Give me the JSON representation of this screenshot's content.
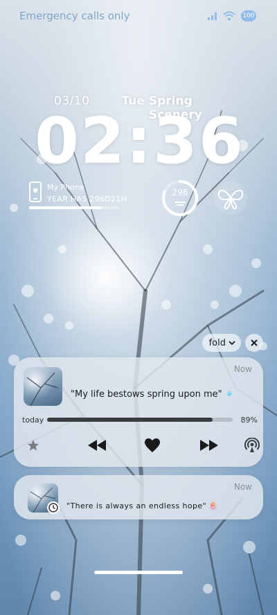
{
  "status_bar": {
    "carrier_text": "Emergency calls only",
    "battery_level": "100",
    "icons": [
      "signal-icon",
      "wifi-icon",
      "battery-icon"
    ]
  },
  "lockscreen": {
    "date": "03/10",
    "weekday": "Tue",
    "subtitle": "Spring Scenery",
    "time": "02:36"
  },
  "widgets": {
    "device_name": "My Phone",
    "year_text": "YEAR HAS 296D21H",
    "year_progress_fraction": 0.81,
    "ring_value": "296",
    "ring_fraction": 0.81,
    "butterfly_icon": "butterfly-icon"
  },
  "notification_controls": {
    "fold_label": "fold"
  },
  "music_card": {
    "time_label": "Now",
    "quote": "\"My life bestows spring upon me\"",
    "progress_label": "today",
    "progress_value": "89%",
    "progress_fraction": 0.89,
    "controls": [
      "star-icon",
      "previous-icon",
      "heart-icon",
      "next-icon",
      "airplay-icon"
    ]
  },
  "note_card": {
    "time_label": "Now",
    "quote": "\"There is always an endless hope\""
  },
  "colors": {
    "status_text": "#7fa6c8",
    "battery": "#8fbce8",
    "card_bg": "#e2e8ee",
    "bar_fill": "#3a3d40"
  }
}
